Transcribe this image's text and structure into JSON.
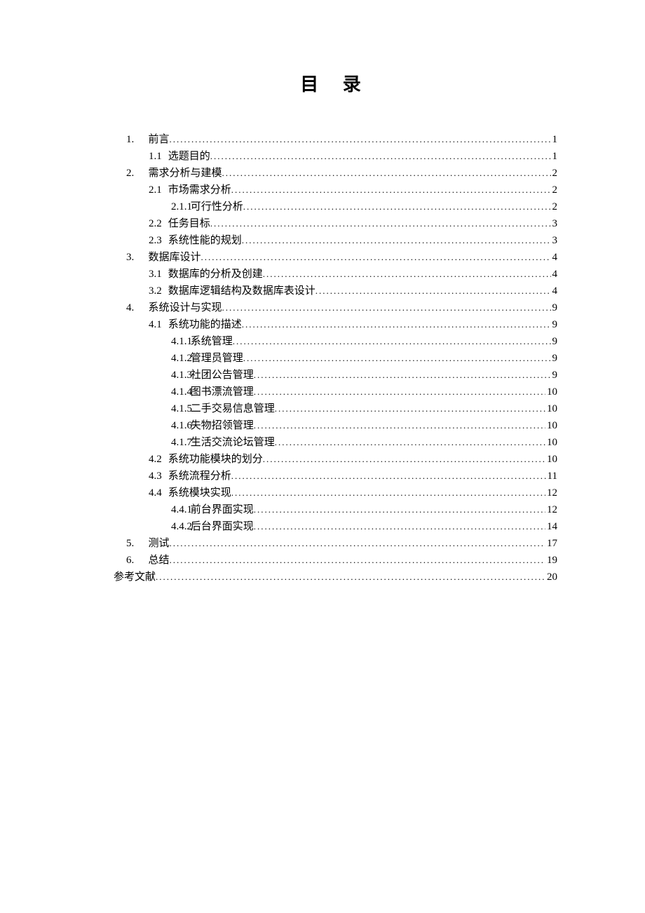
{
  "title": "目 录",
  "entries": [
    {
      "level": 1,
      "num": "1.",
      "label": "前言",
      "page": "1"
    },
    {
      "level": 2,
      "num": "1.1",
      "label": "选题目的",
      "page": "1"
    },
    {
      "level": 1,
      "num": "2.",
      "label": "需求分析与建模",
      "page": "2"
    },
    {
      "level": 2,
      "num": "2.1",
      "label": "市场需求分析",
      "page": "2"
    },
    {
      "level": 3,
      "num": "2.1.1",
      "label": "可行性分析",
      "page": "2"
    },
    {
      "level": 2,
      "num": "2.2",
      "label": "任务目标",
      "page": "3"
    },
    {
      "level": 2,
      "num": "2.3",
      "label": "系统性能的规划",
      "page": "3"
    },
    {
      "level": 1,
      "num": "3.",
      "label": "数据库设计",
      "page": "4"
    },
    {
      "level": 2,
      "num": "3.1",
      "label": "数据库的分析及创建",
      "page": "4"
    },
    {
      "level": 2,
      "num": "3.2",
      "label": "数据库逻辑结构及数据库表设计",
      "page": "4"
    },
    {
      "level": 1,
      "num": "4.",
      "label": "系统设计与实现",
      "page": "9"
    },
    {
      "level": 2,
      "num": "4.1",
      "label": "系统功能的描述",
      "page": "9"
    },
    {
      "level": 3,
      "num": "4.1.1",
      "label": "系统管理",
      "page": "9"
    },
    {
      "level": 3,
      "num": "4.1.2",
      "label": "管理员管理",
      "page": "9"
    },
    {
      "level": 3,
      "num": "4.1.3",
      "label": "社团公告管理",
      "page": "9"
    },
    {
      "level": 3,
      "num": "4.1.4",
      "label": "图书漂流管理",
      "page": "10"
    },
    {
      "level": 3,
      "num": "4.1.5",
      "label": "二手交易信息管理",
      "page": "10"
    },
    {
      "level": 3,
      "num": "4.1.6",
      "label": "失物招领管理",
      "page": "10"
    },
    {
      "level": 3,
      "num": "4.1.7",
      "label": "生活交流论坛管理",
      "page": "10"
    },
    {
      "level": 2,
      "num": "4.2",
      "label": "系统功能模块的划分",
      "page": "10"
    },
    {
      "level": 2,
      "num": "4.3",
      "label": "系统流程分析",
      "page": "11"
    },
    {
      "level": 2,
      "num": "4.4",
      "label": "系统模块实现",
      "page": "12"
    },
    {
      "level": 3,
      "num": "4.4.1",
      "label": "前台界面实现",
      "page": "12"
    },
    {
      "level": 3,
      "num": "4.4.2",
      "label": "后台界面实现",
      "page": "14"
    },
    {
      "level": 1,
      "num": "5.",
      "label": "测试",
      "page": "17"
    },
    {
      "level": 1,
      "num": "6.",
      "label": "总结",
      "page": "19"
    },
    {
      "level": 0,
      "num": "",
      "label": "参考文献",
      "page": "20"
    }
  ]
}
